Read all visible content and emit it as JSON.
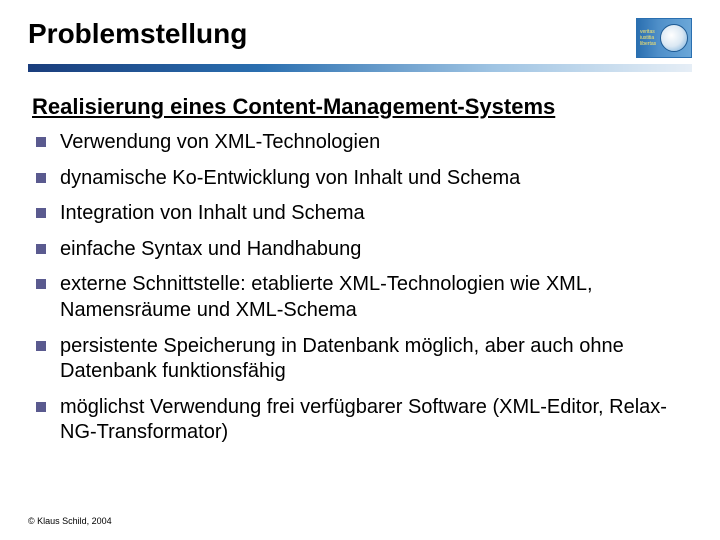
{
  "header": {
    "title": "Problemstellung",
    "logo_words": [
      "veritas",
      "iustitia",
      "libertas"
    ]
  },
  "content": {
    "subtitle": "Realisierung eines Content-Management-Systems",
    "bullets": [
      "Verwendung von XML-Technologien",
      "dynamische Ko-Entwicklung von Inhalt und Schema",
      "Integration von Inhalt und Schema",
      "einfache Syntax und Handhabung",
      "externe Schnittstelle: etablierte XML-Technologien wie XML, Namensräume und XML-Schema",
      "persistente Speicherung in Datenbank möglich, aber auch ohne Datenbank funktionsfähig",
      "möglichst Verwendung frei verfügbarer Software (XML-Editor, Relax-NG-Transformator)"
    ]
  },
  "footer": {
    "copyright": "© Klaus Schild, 2004"
  }
}
